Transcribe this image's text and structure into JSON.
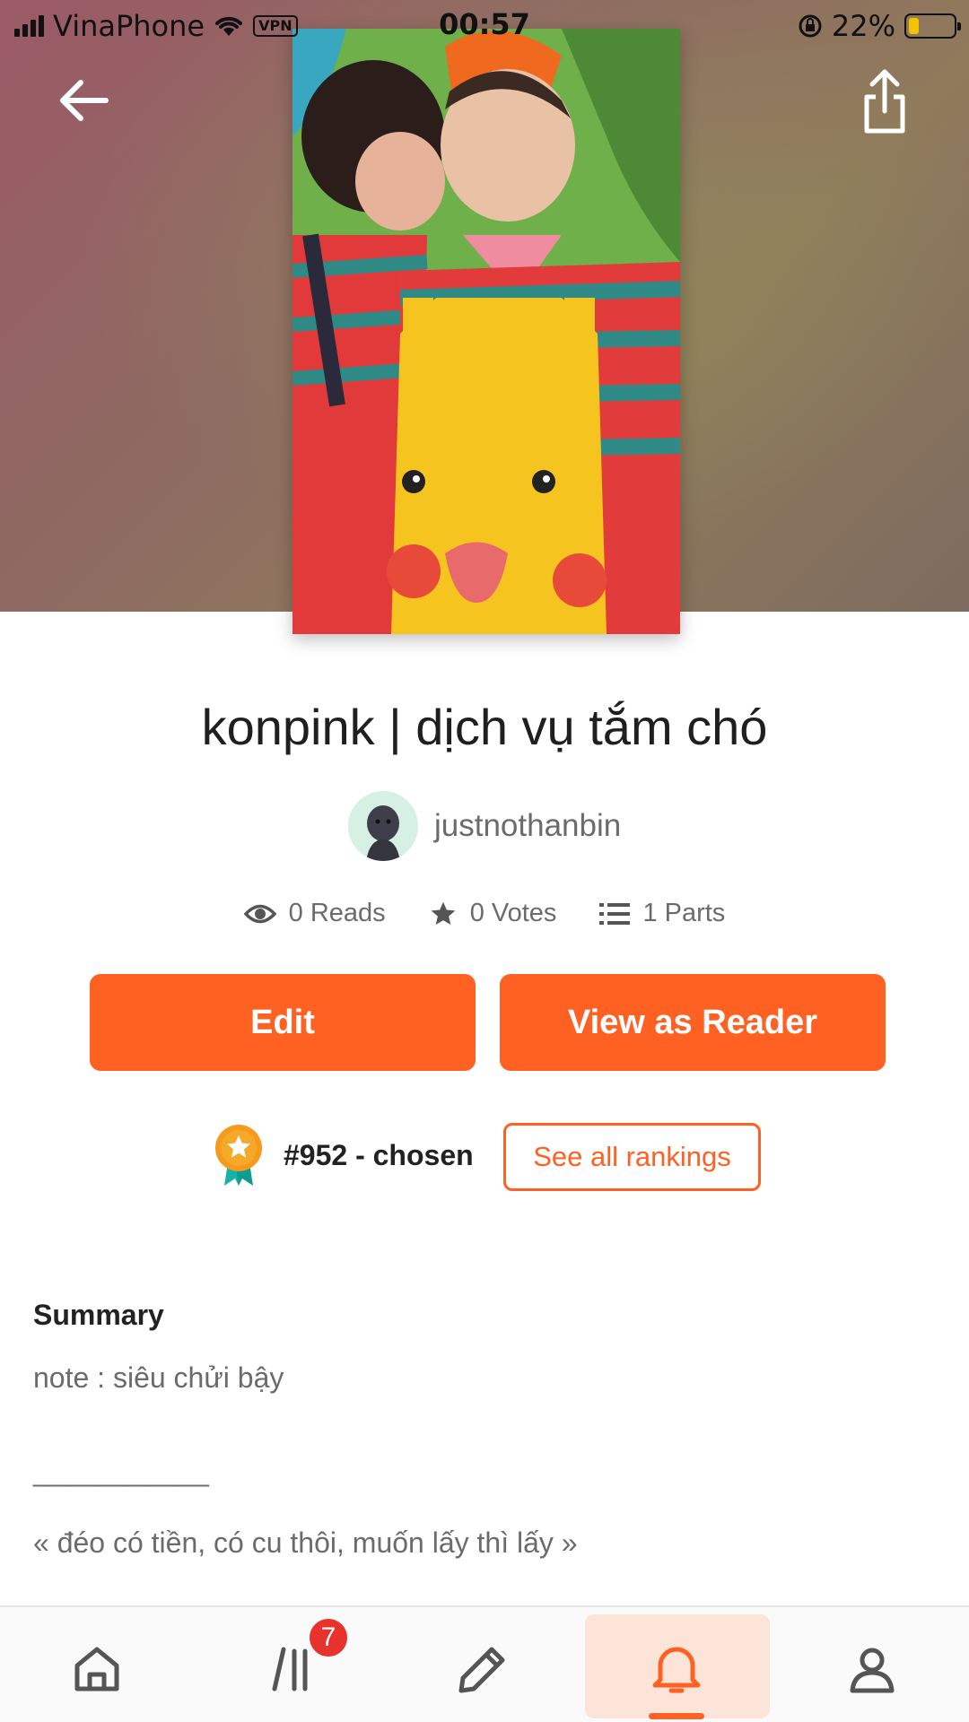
{
  "status_bar": {
    "carrier": "VinaPhone",
    "vpn": "VPN",
    "time": "00:57",
    "battery_percent": "22%",
    "battery_level": 0.22
  },
  "story": {
    "title": "konpink | dịch vụ tắm chó",
    "author": "justnothanbin",
    "stats": {
      "reads": "0 Reads",
      "votes": "0 Votes",
      "parts": "1 Parts"
    }
  },
  "actions": {
    "edit_label": "Edit",
    "reader_label": "View as Reader"
  },
  "ranking": {
    "text": "#952 - chosen",
    "see_all": "See all rankings"
  },
  "summary": {
    "heading": "Summary",
    "lines": [
      "note : siêu chửi bậy",
      "___________",
      "« đéo có tiền, có cu thôi, muốn lấy thì lấy »"
    ]
  },
  "bottom_nav": {
    "library_badge": "7",
    "active_tab": "notifications",
    "icons": [
      "home-icon",
      "library-icon",
      "pencil-icon",
      "bell-icon",
      "profile-icon"
    ]
  },
  "colors": {
    "accent": "#ff6122",
    "badge": "#e8322c"
  }
}
